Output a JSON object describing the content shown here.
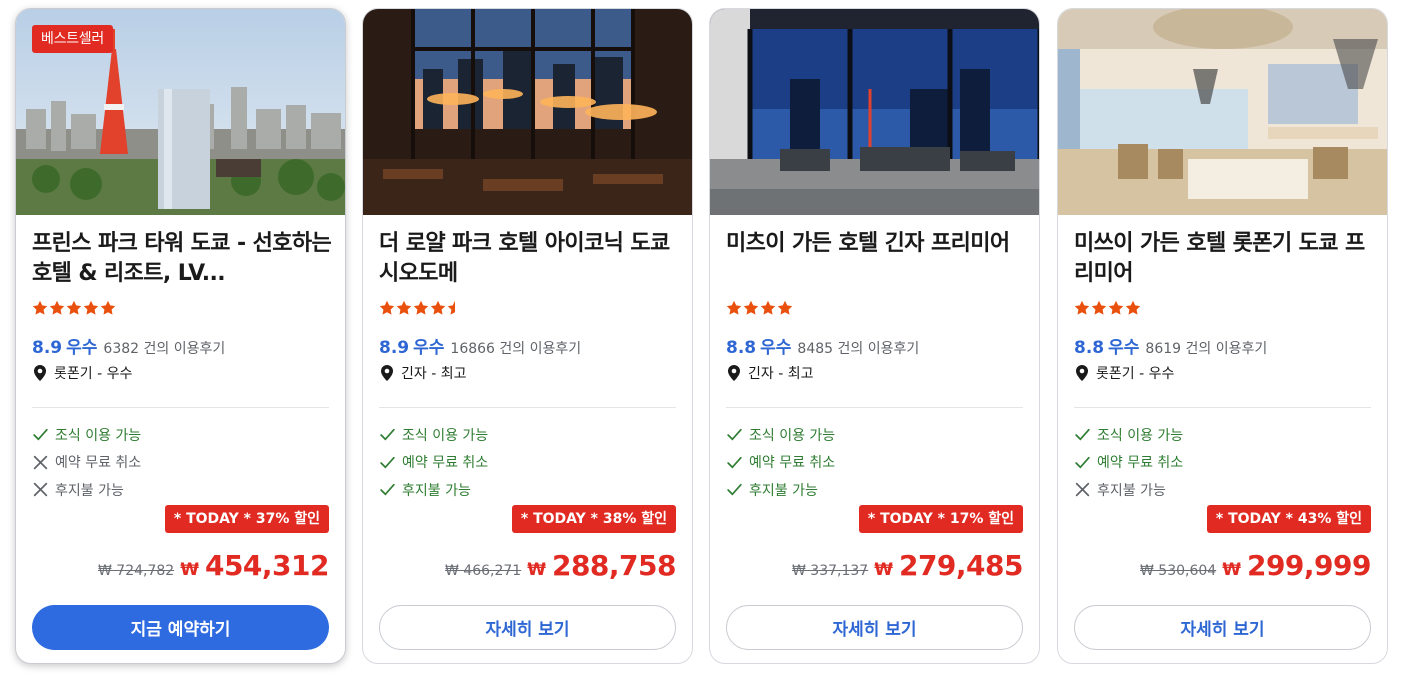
{
  "colors": {
    "accent_blue": "#2e6be0",
    "rating_blue": "#2e67d3",
    "deal_red": "#e02a22",
    "star_orange": "#e9500e",
    "ok_green": "#2f7d32",
    "muted_gray": "#5f6368"
  },
  "hotels": [
    {
      "badge": "베스트셀러",
      "name": "프린스 파크 타워 도쿄 - 선호하는 호텔 & 리조트, LV...",
      "stars": 5,
      "score": "8.9",
      "score_label": "우수",
      "reviews": "6382 건의 이용후기",
      "location": "롯폰기 - 우수",
      "features": [
        {
          "label": "조식 이용 가능",
          "available": true,
          "icon": "check-icon"
        },
        {
          "label": "예약 무료 취소",
          "available": false,
          "icon": "x-icon"
        },
        {
          "label": "후지불 가능",
          "available": false,
          "icon": "x-icon"
        }
      ],
      "deal": "* TODAY * 37% 할인",
      "old_price": "₩ 724,782",
      "currency": "₩",
      "new_price": "454,312",
      "button": "지금 예약하기",
      "button_style": "primary"
    },
    {
      "badge": "",
      "name": "더 로얄 파크 호텔 아이코닉 도쿄 시오도메",
      "stars": 4.5,
      "score": "8.9",
      "score_label": "우수",
      "reviews": "16866 건의 이용후기",
      "location": "긴자 - 최고",
      "features": [
        {
          "label": "조식 이용 가능",
          "available": true,
          "icon": "check-icon"
        },
        {
          "label": "예약 무료 취소",
          "available": true,
          "icon": "check-icon"
        },
        {
          "label": "후지불 가능",
          "available": true,
          "icon": "check-icon"
        }
      ],
      "deal": "* TODAY * 38% 할인",
      "old_price": "₩ 466,271",
      "currency": "₩",
      "new_price": "288,758",
      "button": "자세히 보기",
      "button_style": "secondary"
    },
    {
      "badge": "",
      "name": "미츠이 가든 호텔 긴자 프리미어",
      "stars": 4,
      "score": "8.8",
      "score_label": "우수",
      "reviews": "8485 건의 이용후기",
      "location": "긴자 - 최고",
      "features": [
        {
          "label": "조식 이용 가능",
          "available": true,
          "icon": "check-icon"
        },
        {
          "label": "예약 무료 취소",
          "available": true,
          "icon": "check-icon"
        },
        {
          "label": "후지불 가능",
          "available": true,
          "icon": "check-icon"
        }
      ],
      "deal": "* TODAY * 17% 할인",
      "old_price": "₩ 337,137",
      "currency": "₩",
      "new_price": "279,485",
      "button": "자세히 보기",
      "button_style": "secondary"
    },
    {
      "badge": "",
      "name": "미쓰이 가든 호텔 롯폰기 도쿄 프리미어",
      "stars": 4,
      "score": "8.8",
      "score_label": "우수",
      "reviews": "8619 건의 이용후기",
      "location": "롯폰기 - 우수",
      "features": [
        {
          "label": "조식 이용 가능",
          "available": true,
          "icon": "check-icon"
        },
        {
          "label": "예약 무료 취소",
          "available": true,
          "icon": "check-icon"
        },
        {
          "label": "후지불 가능",
          "available": false,
          "icon": "x-icon"
        }
      ],
      "deal": "* TODAY * 43% 할인",
      "old_price": "₩ 530,604",
      "currency": "₩",
      "new_price": "299,999",
      "button": "자세히 보기",
      "button_style": "secondary"
    }
  ]
}
